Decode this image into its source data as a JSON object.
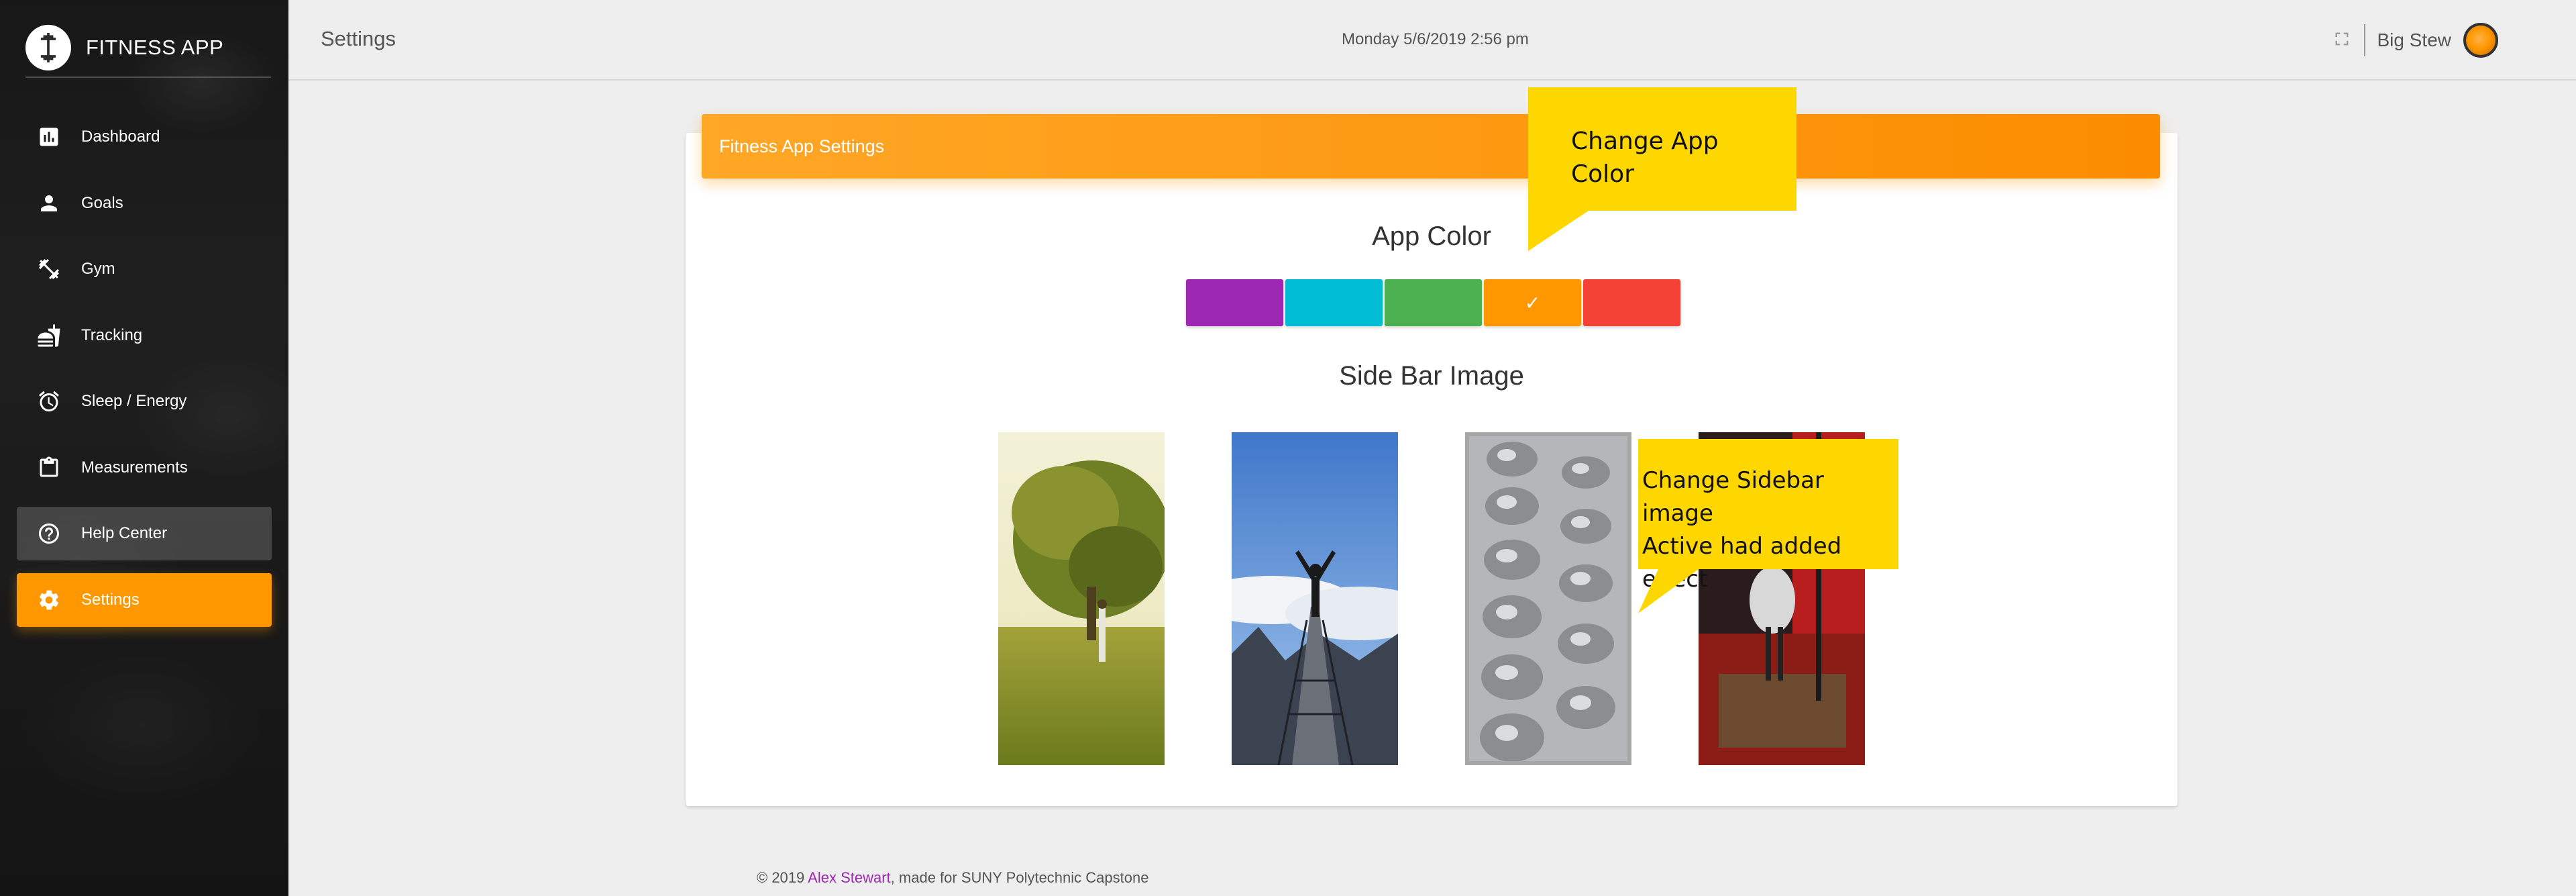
{
  "app": {
    "name": "FITNESS APP"
  },
  "sidebar": {
    "items": [
      {
        "label": "Dashboard",
        "icon": "bar-chart-icon",
        "state": "normal"
      },
      {
        "label": "Goals",
        "icon": "person-icon",
        "state": "normal"
      },
      {
        "label": "Gym",
        "icon": "dumbbell-icon",
        "state": "normal"
      },
      {
        "label": "Tracking",
        "icon": "fastfood-icon",
        "state": "normal"
      },
      {
        "label": "Sleep / Energy",
        "icon": "alarm-icon",
        "state": "normal"
      },
      {
        "label": "Measurements",
        "icon": "clipboard-icon",
        "state": "normal"
      },
      {
        "label": "Help Center",
        "icon": "help-circle-icon",
        "state": "hover"
      },
      {
        "label": "Settings",
        "icon": "gear-icon",
        "state": "active"
      }
    ]
  },
  "header": {
    "title": "Settings",
    "datetime": "Monday 5/6/2019 2:56 pm",
    "fullscreen_icon": "fullscreen-icon",
    "user_name": "Big Stew"
  },
  "settings": {
    "card_title": "Fitness App Settings",
    "app_color_title": "App Color",
    "colors": [
      {
        "name": "purple",
        "hex": "#9c27b0",
        "selected": false
      },
      {
        "name": "cyan",
        "hex": "#00bcd4",
        "selected": false
      },
      {
        "name": "green",
        "hex": "#4caf50",
        "selected": false
      },
      {
        "name": "orange",
        "hex": "#ff9800",
        "selected": true
      },
      {
        "name": "red",
        "hex": "#f44336",
        "selected": false
      }
    ],
    "check_glyph": "✓",
    "sidebar_image_title": "Side Bar Image",
    "images": [
      {
        "name": "tree-field",
        "active": false
      },
      {
        "name": "mountain-person",
        "active": false
      },
      {
        "name": "dumbbell-rack",
        "active": true
      },
      {
        "name": "gym-red",
        "active": false
      }
    ]
  },
  "callouts": {
    "app_color": {
      "line1": "Change App",
      "line2": "Color"
    },
    "sidebar_image": {
      "line1": "Change Sidebar image",
      "line2": "Active had added effect"
    }
  },
  "footer": {
    "prefix": "© 2019 ",
    "author": "Alex Stewart",
    "suffix": ", made for SUNY Polytechnic Capstone"
  },
  "colors": {
    "accent": "#ff9800",
    "callout": "#ffd700"
  }
}
